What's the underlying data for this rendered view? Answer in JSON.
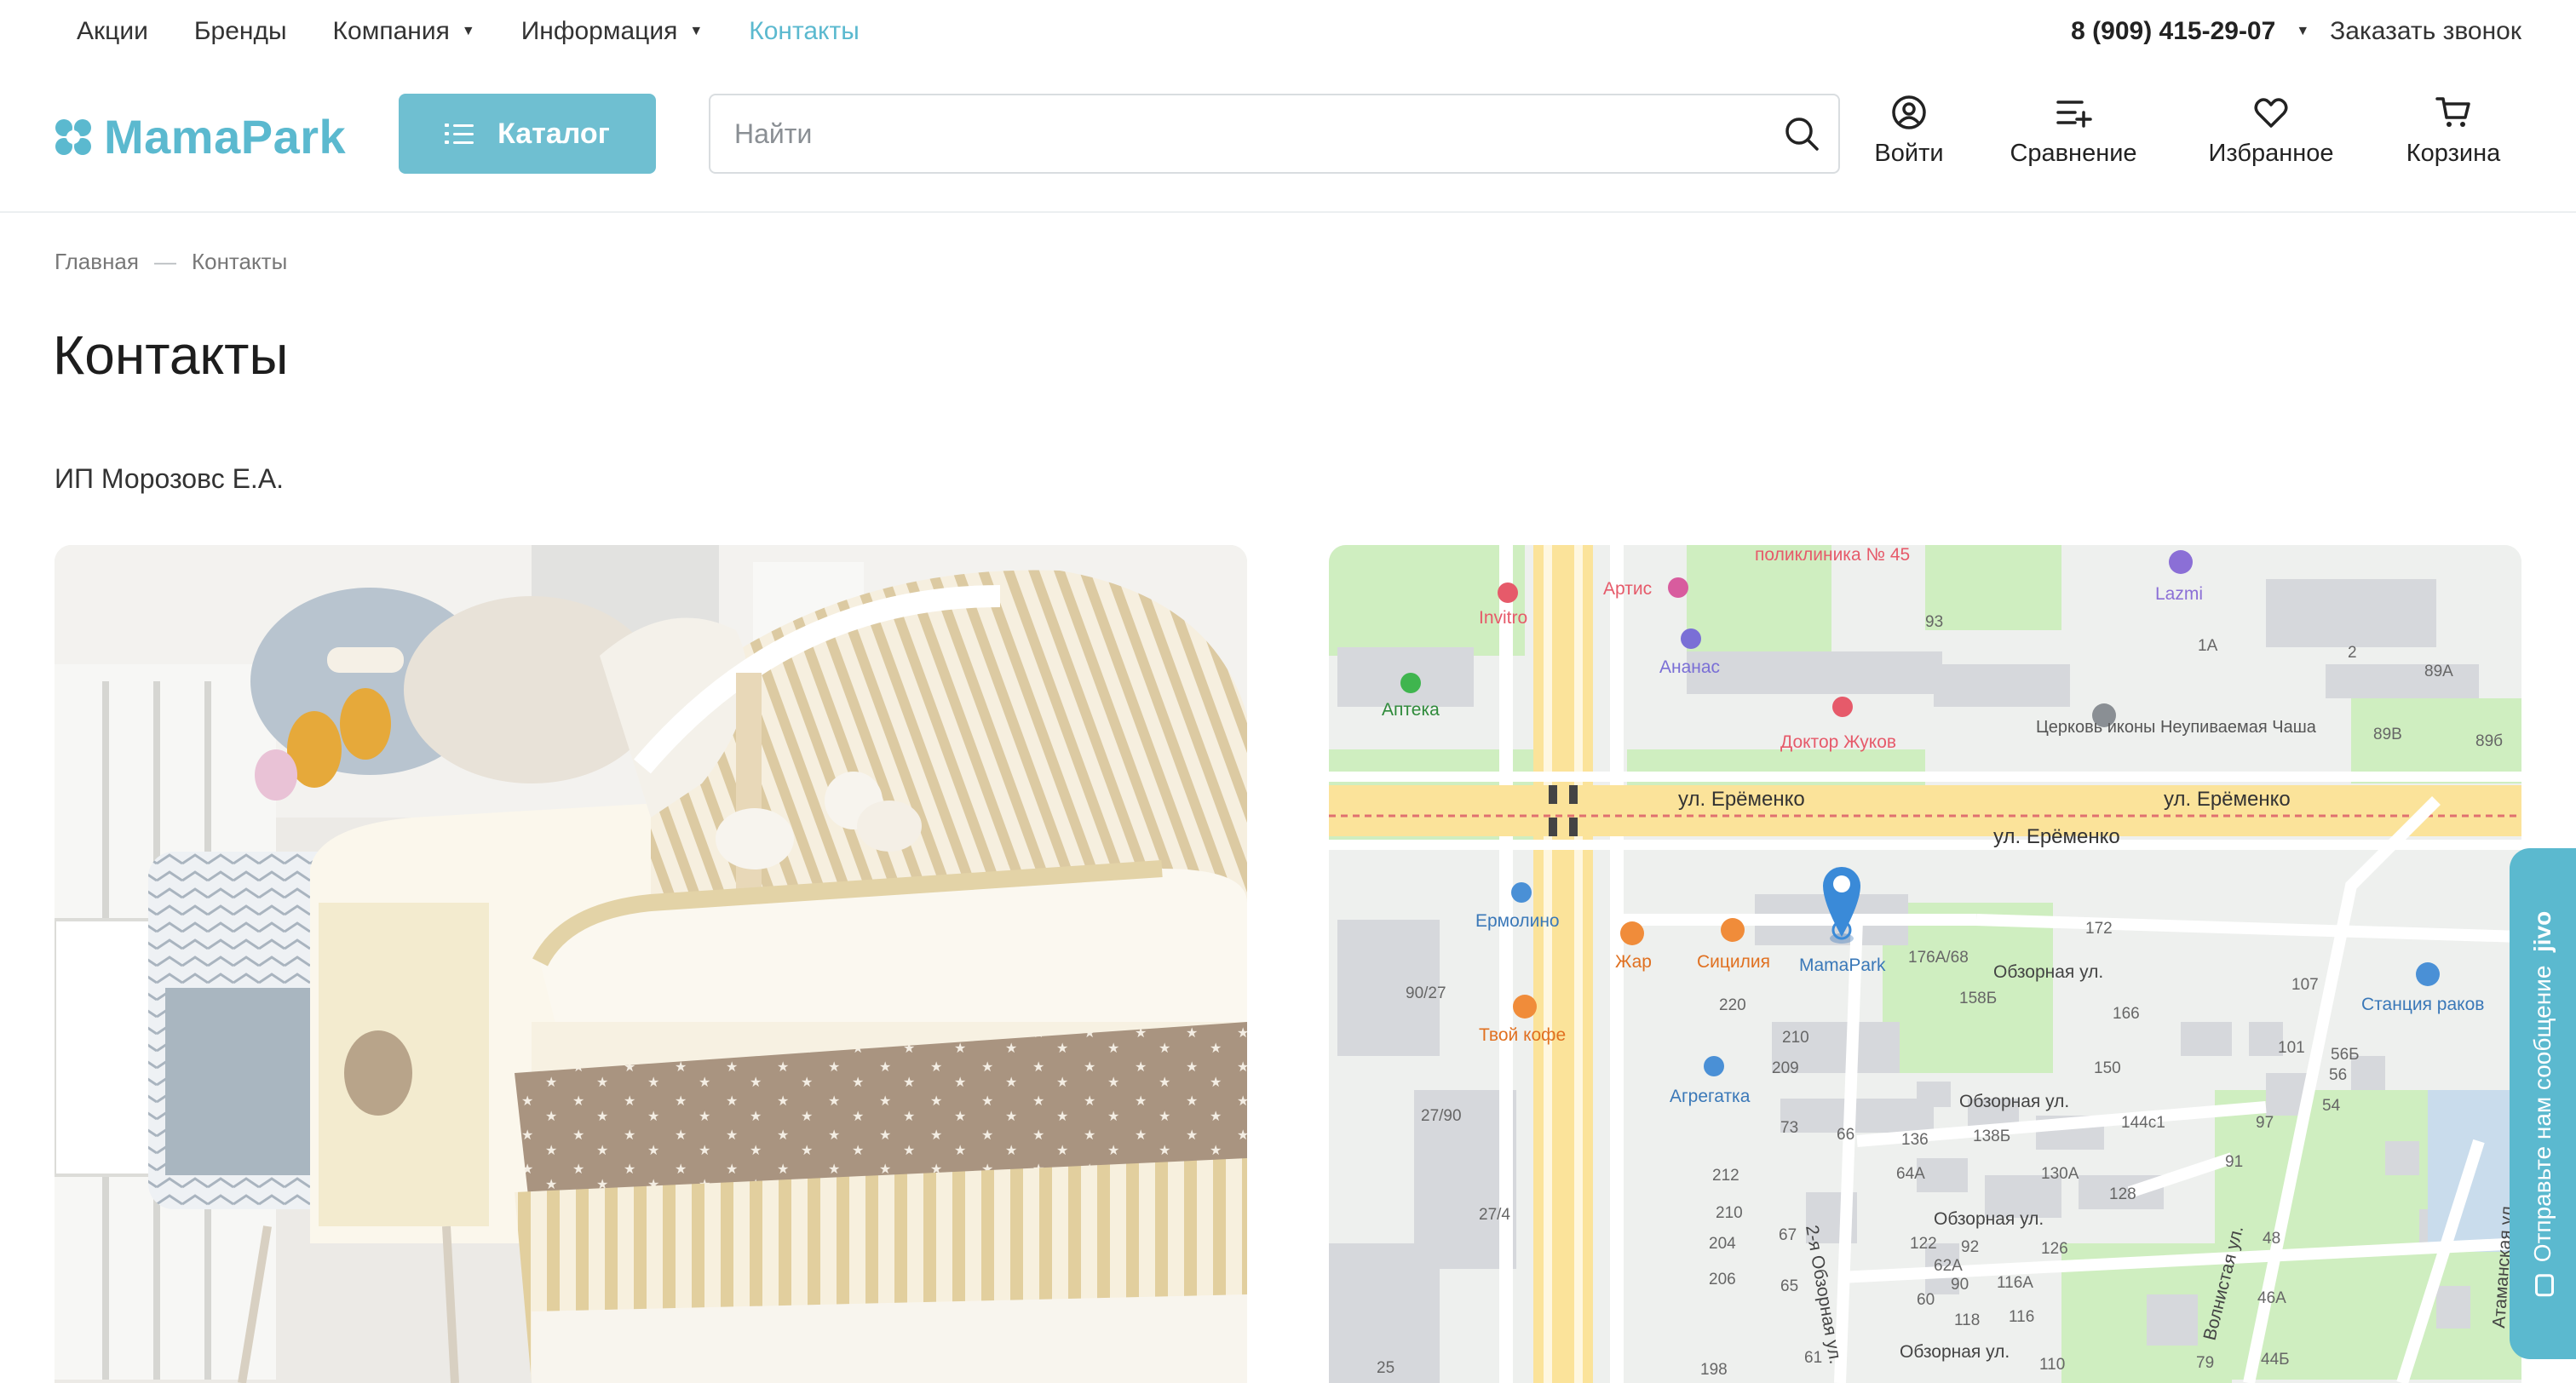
{
  "topnav": {
    "items": [
      {
        "label": "Акции",
        "dropdown": false
      },
      {
        "label": "Бренды",
        "dropdown": false
      },
      {
        "label": "Компания",
        "dropdown": true
      },
      {
        "label": "Информация",
        "dropdown": true
      },
      {
        "label": "Контакты",
        "dropdown": false,
        "active": true
      }
    ],
    "phone": "8 (909) 415-29-07",
    "callback": "Заказать звонок"
  },
  "header": {
    "logo_text": "MamaPark",
    "catalog_label": "Каталог",
    "search_placeholder": "Найти",
    "actions": {
      "login": "Войти",
      "compare": "Сравнение",
      "favorites": "Избранное",
      "cart": "Корзина"
    }
  },
  "breadcrumb": {
    "home": "Главная",
    "separator": "—",
    "current": "Контакты"
  },
  "page": {
    "title": "Контакты",
    "company": "ИП Морозовс Е.А."
  },
  "map": {
    "streets": [
      "ул. Ерёменко",
      "ул. Ерёменко",
      "ул. Ерёменко",
      "Обзорная ул.",
      "Обзорная ул.",
      "Обзорная ул.",
      "Обзорная ул.",
      "2-я Обзорная ул.",
      "Волнистая ул.",
      "Атаманская ул."
    ],
    "places": [
      "поликлиника № 45",
      "Артис",
      "Invitro",
      "Lazmi",
      "Аптека",
      "Ананас",
      "Доктор Жуков",
      "Церковь иконы Неупиваемая Чаша",
      "Ермолино",
      "Жар",
      "Сицилия",
      "MamaPark",
      "Станция раков",
      "Твой кофе",
      "Агрегатка"
    ],
    "house_numbers": [
      "93",
      "1А",
      "2",
      "89А",
      "89В",
      "89б",
      "90/27",
      "220",
      "210",
      "209",
      "176А/68",
      "172",
      "158Б",
      "166",
      "107",
      "101",
      "56Б",
      "150",
      "56",
      "54",
      "27/90",
      "73",
      "66",
      "136",
      "138Б",
      "144с1",
      "97",
      "64А",
      "130А",
      "128",
      "91",
      "212",
      "210",
      "27/4",
      "204",
      "206",
      "67",
      "65",
      "122",
      "92",
      "126",
      "48",
      "62А",
      "90",
      "116А",
      "46А",
      "60",
      "118",
      "116",
      "198",
      "61",
      "110",
      "79",
      "44Б",
      "25"
    ],
    "marker_label": "MamaPark"
  },
  "jivo": {
    "label": "Отправьте нам сообщение",
    "brand": "jivo"
  },
  "colors": {
    "accent": "#5bb9cf",
    "catalog_button": "#6fbfd1",
    "text": "#333333"
  },
  "icons": [
    "logo-mark-icon",
    "list-icon",
    "search-icon",
    "user-icon",
    "compare-icon",
    "heart-icon",
    "cart-icon",
    "map-pin-icon",
    "chat-icon"
  ]
}
